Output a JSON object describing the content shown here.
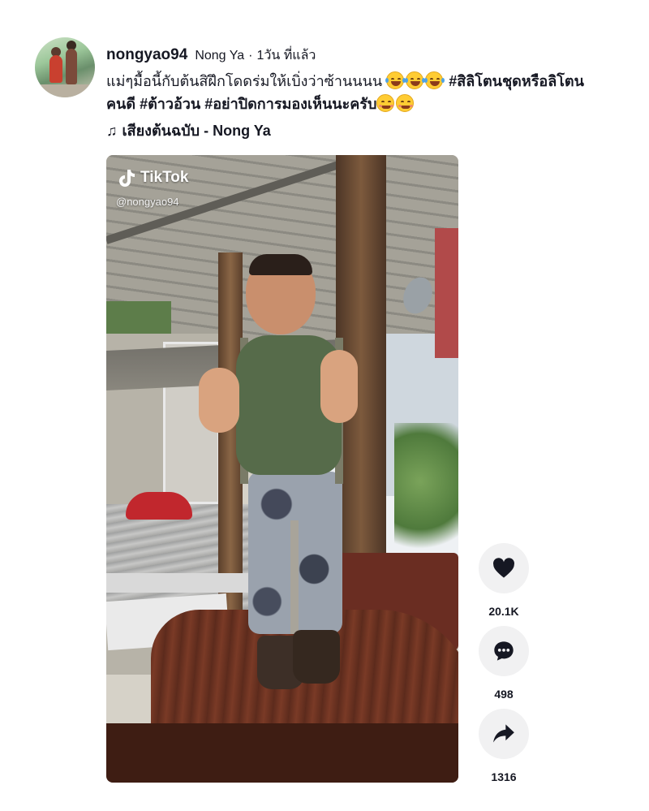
{
  "post": {
    "username": "nongyao94",
    "nickname": "Nong Ya",
    "separator": "·",
    "time_ago": "1วัน ที่แล้ว",
    "caption": {
      "text": "แม่ๆมื้อนี้กับต้นสิฝึกโดดร่มให้เบิ่งว่าซ้านนนน",
      "emojis": [
        "face-with-tears-of-joy",
        "face-with-tears-of-joy",
        "face-with-tears-of-joy"
      ],
      "hashtag1": "#สิลิโตนชุดหรือลิโตน",
      "hashtag1_cont": "คนดี",
      "hashtag2": "#ต้าวอ้วน",
      "hashtag3": "#อย่าปิดการมองเห็นนะครับ",
      "end_emojis": [
        "smiling-face-with-smiling-eyes",
        "smiling-face-with-smiling-eyes"
      ]
    },
    "music": {
      "icon": "music-note-icon",
      "note_glyph": "♫",
      "title": "เสียงต้นฉบับ - Nong Ya"
    }
  },
  "video": {
    "watermark_brand": "TikTok",
    "watermark_handle": "@nongyao94"
  },
  "actions": {
    "like": {
      "icon": "heart-icon",
      "count": "20.1K"
    },
    "comment": {
      "icon": "comment-icon",
      "count": "498"
    },
    "share": {
      "icon": "share-icon",
      "count": "1316"
    }
  },
  "colors": {
    "text": "#161823",
    "action_bg": "#f1f1f2"
  }
}
